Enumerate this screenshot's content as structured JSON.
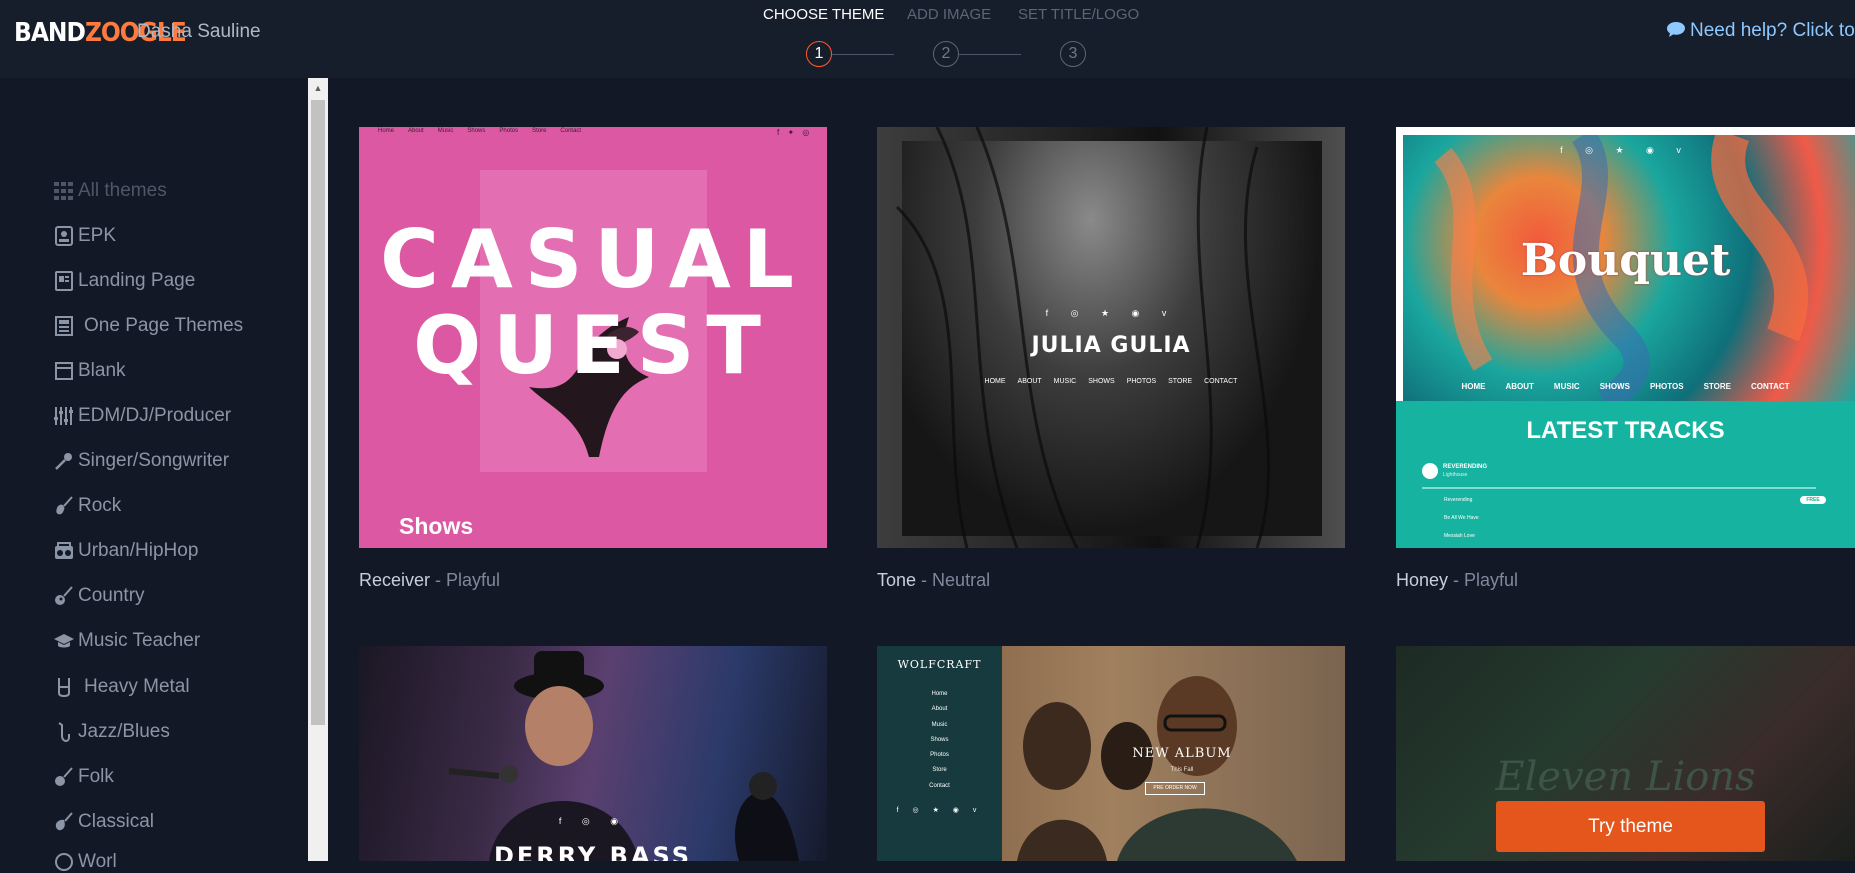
{
  "header": {
    "logo_band": "BAND",
    "logo_zoogle": "ZOOGLE",
    "user_name": "Dasha Sauline",
    "help_text": "Need help? Click to c",
    "steps": [
      {
        "label": "CHOOSE THEME",
        "number": "1",
        "active": true
      },
      {
        "label": "ADD IMAGE",
        "number": "2",
        "active": false
      },
      {
        "label": "SET TITLE/LOGO",
        "number": "3",
        "active": false
      }
    ]
  },
  "sidebar": {
    "items": [
      {
        "label": "All themes",
        "icon": "grid-icon"
      },
      {
        "label": "EPK",
        "icon": "press-kit-icon"
      },
      {
        "label": "Landing Page",
        "icon": "landing-page-icon"
      },
      {
        "label": "One Page Themes",
        "icon": "one-page-icon"
      },
      {
        "label": "Blank",
        "icon": "blank-page-icon"
      },
      {
        "label": "EDM/DJ/Producer",
        "icon": "mixer-sliders-icon"
      },
      {
        "label": "Singer/Songwriter",
        "icon": "microphone-icon"
      },
      {
        "label": "Rock",
        "icon": "electric-guitar-icon"
      },
      {
        "label": "Urban/HipHop",
        "icon": "boombox-icon"
      },
      {
        "label": "Country",
        "icon": "acoustic-guitar-icon"
      },
      {
        "label": "Music Teacher",
        "icon": "graduation-cap-icon"
      },
      {
        "label": "Heavy Metal",
        "icon": "rock-hand-icon"
      },
      {
        "label": "Jazz/Blues",
        "icon": "saxophone-icon"
      },
      {
        "label": "Folk",
        "icon": "banjo-icon"
      },
      {
        "label": "Classical",
        "icon": "violin-icon"
      },
      {
        "label": "Worl",
        "icon": "globe-icon"
      }
    ]
  },
  "themes": [
    {
      "name": "Receiver",
      "style": "Playful",
      "preview": {
        "nav": [
          "Home",
          "About",
          "Music",
          "Shows",
          "Photos",
          "Store",
          "Contact"
        ],
        "title_line1": "CASUAL",
        "title_line2": "QUEST",
        "section": "Shows"
      }
    },
    {
      "name": "Tone",
      "style": "Neutral",
      "preview": {
        "title": "JULIA GULIA",
        "nav": [
          "HOME",
          "ABOUT",
          "MUSIC",
          "SHOWS",
          "PHOTOS",
          "STORE",
          "CONTACT"
        ]
      }
    },
    {
      "name": "Honey",
      "style": "Playful",
      "preview": {
        "title": "Bouquet",
        "nav": [
          "HOME",
          "ABOUT",
          "MUSIC",
          "SHOWS",
          "PHOTOS",
          "STORE",
          "CONTACT"
        ],
        "section": "LATEST TRACKS",
        "track_artist": "REVERENDING",
        "track_sub": "Lighthouse",
        "tracks": [
          "Reverending",
          "Be All We Have",
          "Messiah Love"
        ],
        "free_badge": "FREE"
      }
    },
    {
      "name": "",
      "style": "",
      "preview": {
        "title": "DERRY BASS"
      }
    },
    {
      "name": "",
      "style": "",
      "preview": {
        "brand": "WOLFCRAFT",
        "nav": [
          "Home",
          "About",
          "Music",
          "Shows",
          "Photos",
          "Store",
          "Contact"
        ],
        "headline": "NEW ALBUM",
        "sub": "This Fall",
        "button": "PRE ORDER NOW"
      }
    },
    {
      "name": "",
      "style": "",
      "preview": {
        "title": "Eleven Lions"
      }
    }
  ],
  "try_theme_label": "Try theme",
  "colors": {
    "accent": "#e4561c",
    "step_active": "#ff5a25",
    "help_link": "#8ec8ff",
    "receiver_pink": "#dd58a3",
    "honey_teal": "#17b3a1"
  }
}
